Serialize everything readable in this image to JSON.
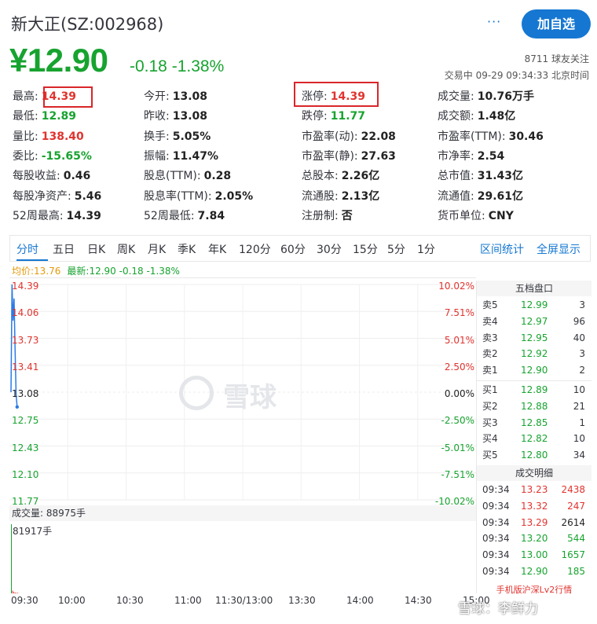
{
  "header": {
    "title": "新大正(SZ:002968)",
    "share_icon": "···",
    "add_button": "加自选",
    "price": "¥12.90",
    "change": "-0.18  -1.38%",
    "followers": "8711 球友关注",
    "trade_status": "交易中  09-29 09:34:33 北京时间"
  },
  "quote": [
    [
      {
        "l": "最高:",
        "v": "14.39",
        "c": "red"
      },
      {
        "l": "今开:",
        "v": "13.08",
        "c": "dark"
      },
      {
        "l": "涨停:",
        "v": "14.39",
        "c": "red"
      },
      {
        "l": "成交量:",
        "v": "10.76万手",
        "c": "dark"
      }
    ],
    [
      {
        "l": "最低:",
        "v": "12.89",
        "c": "green"
      },
      {
        "l": "昨收:",
        "v": "13.08",
        "c": "dark"
      },
      {
        "l": "跌停:",
        "v": "11.77",
        "c": "green"
      },
      {
        "l": "成交额:",
        "v": "1.48亿",
        "c": "dark"
      }
    ],
    [
      {
        "l": "量比:",
        "v": "138.40",
        "c": "red"
      },
      {
        "l": "换手:",
        "v": "5.05%",
        "c": "dark"
      },
      {
        "l": "市盈率(动):",
        "v": "22.08",
        "c": "dark"
      },
      {
        "l": "市盈率(TTM):",
        "v": "30.46",
        "c": "dark"
      }
    ],
    [
      {
        "l": "委比:",
        "v": "-15.65%",
        "c": "green"
      },
      {
        "l": "振幅:",
        "v": "11.47%",
        "c": "dark"
      },
      {
        "l": "市盈率(静):",
        "v": "27.63",
        "c": "dark"
      },
      {
        "l": "市净率:",
        "v": "2.54",
        "c": "dark"
      }
    ],
    [
      {
        "l": "每股收益:",
        "v": "0.46",
        "c": "dark"
      },
      {
        "l": "股息(TTM):",
        "v": "0.28",
        "c": "dark"
      },
      {
        "l": "总股本:",
        "v": "2.26亿",
        "c": "dark"
      },
      {
        "l": "总市值:",
        "v": "31.43亿",
        "c": "dark"
      }
    ],
    [
      {
        "l": "每股净资产:",
        "v": "5.46",
        "c": "dark"
      },
      {
        "l": "股息率(TTM):",
        "v": "2.05%",
        "c": "dark"
      },
      {
        "l": "流通股:",
        "v": "2.13亿",
        "c": "dark"
      },
      {
        "l": "流通值:",
        "v": "29.61亿",
        "c": "dark"
      }
    ],
    [
      {
        "l": "52周最高:",
        "v": "14.39",
        "c": "dark"
      },
      {
        "l": "52周最低:",
        "v": "7.84",
        "c": "dark"
      },
      {
        "l": "注册制:",
        "v": "否",
        "c": "dark"
      },
      {
        "l": "货币单位:",
        "v": "CNY",
        "c": "dark"
      }
    ]
  ],
  "tabs": [
    "分时",
    "五日",
    "日K",
    "周K",
    "月K",
    "季K",
    "年K",
    "120分",
    "60分",
    "30分",
    "15分",
    "5分",
    "1分"
  ],
  "tab_links": [
    "区间统计",
    "全屏显示"
  ],
  "legend": {
    "avg": "均价:13.76",
    "latest": "最新:12.90 -0.18 -1.38%"
  },
  "chart_data": {
    "type": "line",
    "y_left_ticks": [
      "14.39",
      "14.06",
      "13.73",
      "13.41",
      "13.08",
      "12.75",
      "12.43",
      "12.10",
      "11.77"
    ],
    "y_right_ticks": [
      "10.02%",
      "7.51%",
      "5.01%",
      "2.50%",
      "0.00%",
      "-2.50%",
      "-5.01%",
      "-7.51%",
      "-10.02%"
    ],
    "x_ticks": [
      "09:30",
      "10:00",
      "10:30",
      "11:00",
      "11:30/13:00",
      "13:30",
      "14:00",
      "14:30",
      "15:00"
    ],
    "ylim": [
      11.77,
      14.39
    ],
    "series": [
      {
        "values": [
          13.08,
          14.39,
          13.95,
          14.22,
          13.6,
          13.05,
          12.9
        ]
      }
    ],
    "volume_label": "成交量: 88975手",
    "volume_max_label": "81917手",
    "volumes": [
      81917,
      3200,
      1500,
      900,
      700,
      600,
      158
    ]
  },
  "watermark": "雪球",
  "orderbook": {
    "title": "五档盘口",
    "asks": [
      [
        "卖5",
        "12.99",
        "3"
      ],
      [
        "卖4",
        "12.97",
        "96"
      ],
      [
        "卖3",
        "12.95",
        "40"
      ],
      [
        "卖2",
        "12.92",
        "3"
      ],
      [
        "卖1",
        "12.90",
        "2"
      ]
    ],
    "bids": [
      [
        "买1",
        "12.89",
        "10"
      ],
      [
        "买2",
        "12.88",
        "21"
      ],
      [
        "买3",
        "12.85",
        "1"
      ],
      [
        "买4",
        "12.82",
        "10"
      ],
      [
        "买5",
        "12.80",
        "34"
      ]
    ],
    "trades_title": "成交明细",
    "trades": [
      [
        "09:34",
        "13.23",
        "2438",
        "red"
      ],
      [
        "09:34",
        "13.32",
        "247",
        "red"
      ],
      [
        "09:34",
        "13.29",
        "2614",
        "dark"
      ],
      [
        "09:34",
        "13.20",
        "544",
        "green"
      ],
      [
        "09:34",
        "13.00",
        "1657",
        "green"
      ],
      [
        "09:34",
        "12.90",
        "185",
        "green"
      ]
    ],
    "note": "手机版沪深Lv2行情"
  },
  "footer_watermark": "雪球：李鲜力"
}
